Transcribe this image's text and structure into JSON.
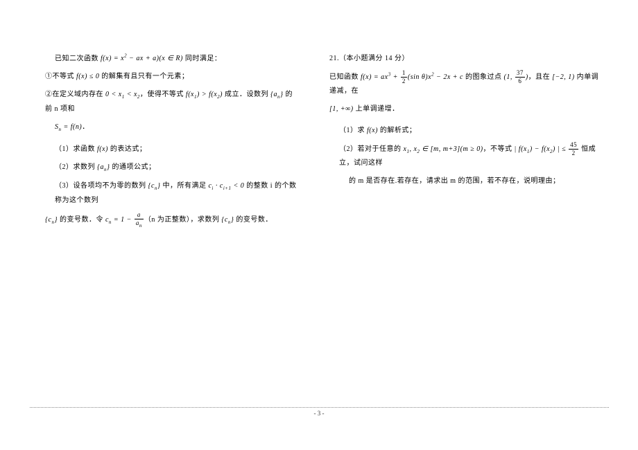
{
  "left": {
    "l1_a": "已知二次函数 ",
    "l1_math": "f(x) = x² − ax + a)(x ∈ R)",
    "l1_b": " 同时满足：",
    "l2_a": "①不等式 ",
    "l2_math": "f(x) ≤ 0",
    "l2_b": " 的解集有且只有一个元素；",
    "l3_a": "②在定义域内存在 ",
    "l3_math": "0 < x₁ < x₂",
    "l3_b": "，使得不等式 ",
    "l3_math2": "f(x₁) > f(x₂)",
    "l3_c": " 成立．设数列 ",
    "l3_math3": "{aₙ}",
    "l3_d": " 的前 n 项和",
    "l4_math": "Sₙ = f(n)",
    "l4_b": "．",
    "q1_a": "（1）求函数 ",
    "q1_math": "f(x)",
    "q1_b": " 的表达式；",
    "q2_a": "（2）求数列 ",
    "q2_math": "{aₙ}",
    "q2_b": " 的通项公式；",
    "q3_a": "（3）设各项均不为零的数列 ",
    "q3_math": "{cₙ}",
    "q3_b": " 中，所有满足 ",
    "q3_math2": "cᵢ · cᵢ₊₁ < 0",
    "q3_c": " 的整数 i 的个数称为这个数列",
    "l5_math": "{cₙ}",
    "l5_a": " 的变号数．令 ",
    "l5_math2_pre": "cₙ = 1 − ",
    "l5_frac_num": "a",
    "l5_frac_den": "aₙ",
    "l5_b": "（n 为正整数），求数列 ",
    "l5_math3": "{cₙ}",
    "l5_c": " 的变号数．"
  },
  "right": {
    "header": "21.（本小题满分 14 分）",
    "l1_a": "已知函数 ",
    "l1_math_pre": "f(x) = ax³ + ",
    "l1_frac1_num": "1",
    "l1_frac1_den": "2",
    "l1_math_mid": "(sin θ)x² − 2x + c",
    "l1_b": " 的图象过点 ",
    "l1_pt_pre": "(1, ",
    "l1_frac2_num": "37",
    "l1_frac2_den": "6",
    "l1_pt_post": ")",
    "l1_c": "，且在 ",
    "l1_interval": "[−2, 1)",
    "l1_d": " 内单调递减，在",
    "l2_interval": "[1, +∞)",
    "l2_a": " 上单调递增．",
    "q1_a": "（1）求 ",
    "q1_math": "f(x)",
    "q1_b": " 的解析式；",
    "q2_a": "（2）若对于任意的 ",
    "q2_math": "x₁, x₂ ∈ [m, m+3](m ≥ 0)",
    "q2_b": "，不等式 ",
    "q2_math2_pre": "| f(x₁) − f(x₂) | ≤ ",
    "q2_frac_num": "45",
    "q2_frac_den": "2",
    "q2_c": " 恒成立，试问这样",
    "l3_a": "的 m 是否存在.若存在，请求出 m 的范围，若不存在，说明理由；"
  },
  "footer": {
    "pagenum": "- 3 -"
  }
}
